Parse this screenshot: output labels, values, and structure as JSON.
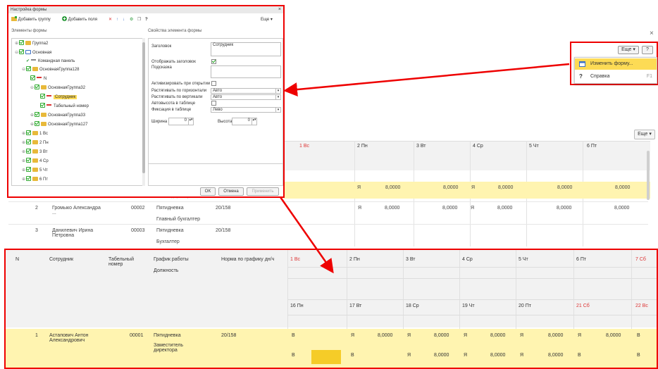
{
  "background": {
    "close_glyph": "×",
    "more_label": "Еще ▾",
    "days": [
      {
        "label": "1 Вс",
        "weekend": true
      },
      {
        "label": "2 Пн",
        "weekend": false
      },
      {
        "label": "3 Вт",
        "weekend": false
      },
      {
        "label": "4 Ср",
        "weekend": false
      },
      {
        "label": "5 Чт",
        "weekend": false
      },
      {
        "label": "6 Пт",
        "weekend": false
      }
    ],
    "rows": [
      {
        "n": "2",
        "name": "Громыко Александра ...",
        "tab": "00002",
        "schedule": "Пятидневка",
        "norm": "20/158",
        "position": "Главный бухгалтер"
      },
      {
        "n": "3",
        "name": "Данилевич Ирина Петровна",
        "tab": "00003",
        "schedule": "Пятидневка",
        "norm": "20/158",
        "position": "Бухгалтер"
      }
    ],
    "mark": "Я",
    "hours": "8,0000",
    "hours_short": "8,000",
    "partial_position": "Заместитель директора"
  },
  "menu": {
    "more_label": "Еще ▾",
    "help_button": "?",
    "items": [
      {
        "label": "Изменить форму...",
        "shortcut": "",
        "icon": "form-edit-icon"
      },
      {
        "label": "Справка",
        "shortcut": "F1",
        "icon": "help-icon"
      }
    ]
  },
  "dialog": {
    "title": "Настройка формы",
    "close_glyph": "×",
    "toolbar": {
      "add_group": "Добавить группу",
      "add_fields": "Добавить поля",
      "more": "Еще ▾",
      "help": "?"
    },
    "elements_label": "Элементы формы",
    "props_label": "Свойства элемента формы",
    "tree": [
      {
        "label": "Группа2",
        "indent": 0,
        "type": "folder"
      },
      {
        "label": "Основная",
        "indent": 0,
        "type": "table"
      },
      {
        "label": "Командная панель",
        "indent": 1,
        "type": "panel"
      },
      {
        "label": "ОсновнаяГруппа128",
        "indent": 1,
        "type": "folder"
      },
      {
        "label": "N",
        "indent": 2,
        "type": "field"
      },
      {
        "label": "ОсновнаяГруппа32",
        "indent": 2,
        "type": "folder"
      },
      {
        "label": "Сотрудник",
        "indent": 3,
        "type": "field",
        "selected": true
      },
      {
        "label": "Табельный номер",
        "indent": 3,
        "type": "field"
      },
      {
        "label": "ОсновнаяГруппа33",
        "indent": 2,
        "type": "folder"
      },
      {
        "label": "ОсновнаяГруппа127",
        "indent": 2,
        "type": "folder"
      },
      {
        "label": "1 Вс",
        "indent": 1,
        "type": "folder"
      },
      {
        "label": "2 Пн",
        "indent": 1,
        "type": "folder"
      },
      {
        "label": "3 Вт",
        "indent": 1,
        "type": "folder"
      },
      {
        "label": "4 Ср",
        "indent": 1,
        "type": "folder"
      },
      {
        "label": "5 Чт",
        "indent": 1,
        "type": "folder"
      },
      {
        "label": "6 Пт",
        "indent": 1,
        "type": "folder"
      }
    ],
    "props": {
      "title_label": "Заголовок",
      "title_value": "Сотрудник",
      "show_title_label": "Отображать заголовок",
      "hint_label": "Подсказка",
      "activate_label": "Активизировать при открытии",
      "stretch_h_label": "Растягивать по горизонтали",
      "stretch_h_value": "Авто",
      "stretch_v_label": "Растягивать по вертикали",
      "stretch_v_value": "Авто",
      "autoheight_label": "Автовысота в таблице",
      "fixation_label": "Фиксация в таблице",
      "fixation_value": "Лево",
      "width_label": "Ширина",
      "width_value": "0",
      "height_label": "Высота",
      "height_value": "0"
    },
    "buttons": {
      "ok": "OK",
      "cancel": "Отмена",
      "apply": "Применить"
    }
  },
  "lower": {
    "headers": {
      "n": "N",
      "employee": "Сотрудник",
      "tab": "Табельный номер",
      "schedule": "График работы",
      "position": "Должность",
      "norm": "Норма по графику дн/ч"
    },
    "days_top": [
      {
        "label": "1 Вс",
        "weekend": true
      },
      {
        "label": "2 Пн",
        "weekend": false
      },
      {
        "label": "3 Вт",
        "weekend": false
      },
      {
        "label": "4 Ср",
        "weekend": false
      },
      {
        "label": "5 Чт",
        "weekend": false
      },
      {
        "label": "6 Пт",
        "weekend": false
      },
      {
        "label": "7 Сб",
        "weekend": true
      }
    ],
    "days_bottom": [
      {
        "label": "16 Пн",
        "weekend": false
      },
      {
        "label": "17 Вт",
        "weekend": false
      },
      {
        "label": "18 Ср",
        "weekend": false
      },
      {
        "label": "19 Чт",
        "weekend": false
      },
      {
        "label": "20 Пт",
        "weekend": false
      },
      {
        "label": "21 Сб",
        "weekend": true
      },
      {
        "label": "22 Вс",
        "weekend": true
      }
    ],
    "row": {
      "n": "1",
      "employee": "Астапович Антон Александрович",
      "tab": "00001",
      "schedule": "Пятидневка",
      "norm": "20/158",
      "position": "Заместитель директора",
      "mark_weekend": "В",
      "mark_work": "Я",
      "hours": "8,0000"
    }
  },
  "colors": {
    "accent_red": "#e00000",
    "highlight": "#fddb55",
    "row_yellow": "#fff4b0"
  }
}
